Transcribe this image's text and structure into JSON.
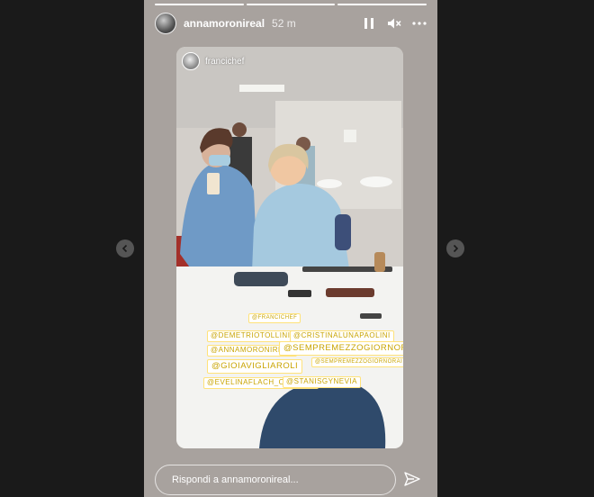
{
  "header": {
    "username": "annamoronireal",
    "time": "52 m",
    "progress_segments": 3,
    "active_segment": 2
  },
  "card": {
    "username": "francichef"
  },
  "tags": {
    "t1": "@DEMETRIOTOLLINI",
    "t2": "@ANNAMORONIREAL",
    "t3": "@GIOIAVIGLIAROLI",
    "t4": "@EVELINAFLACH_OFFICIAL",
    "t5": "@CRISTINALUNAPAOLINI",
    "t6": "@SEMPREMEZZOGIORNORAI",
    "t7": "@SEMPREMEZZOGIORNORAI",
    "t8": "@STANISGYNEVIA",
    "t9": "@FRANCICHEF"
  },
  "reply": {
    "placeholder": "Rispondi a annamoronireal..."
  },
  "icons": {
    "pause": "pause-icon",
    "mute": "mute-icon",
    "more": "more-icon",
    "send": "send-icon",
    "prev": "chevron-left-icon",
    "next": "chevron-right-icon"
  },
  "colors": {
    "background": "#1a1a1a",
    "tag_text": "#c9a400"
  }
}
